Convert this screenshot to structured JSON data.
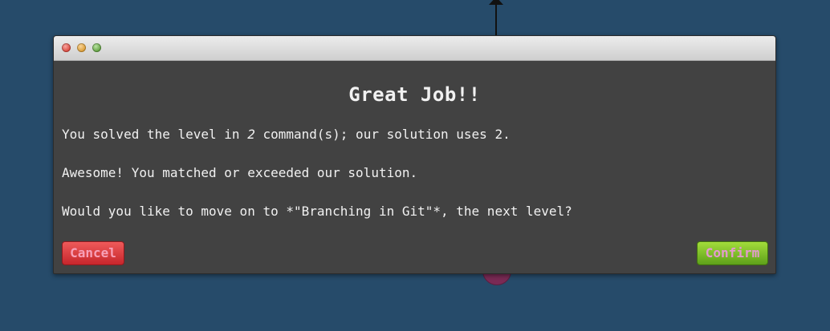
{
  "dialog": {
    "title": "Great Job!!",
    "line1_before": "You solved the level in ",
    "line1_count": "2",
    "line1_after": " command(s); our solution uses 2.",
    "line2": "Awesome! You matched or exceeded our solution.",
    "line3": "Would you like to move on to *\"Branching in Git\"*, the next level?",
    "cancel_label": "Cancel",
    "confirm_label": "Confirm"
  },
  "colors": {
    "background": "#264b6a",
    "dialog_body": "#424242",
    "cancel": "#d53a3f",
    "confirm": "#7cc12a"
  }
}
